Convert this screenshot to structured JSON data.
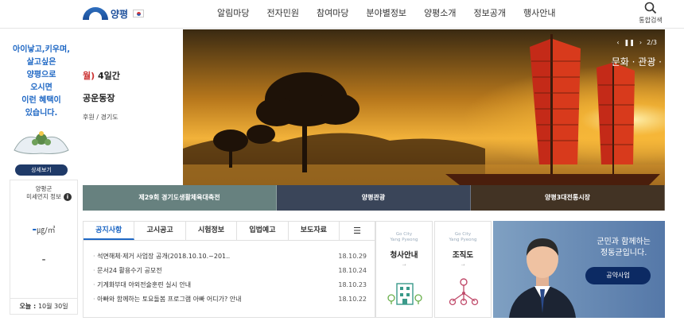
{
  "header": {
    "logo_text": "양평",
    "nav": [
      "알림마당",
      "전자민원",
      "참여마당",
      "분야별정보",
      "양평소개",
      "정보공개",
      "행사안내"
    ],
    "search_label": "통합검색"
  },
  "sidebar": {
    "promo_text": "아이낳고,키우며,\n살고싶은\n양평으로\n오시면\n이런 혜택이\n있습니다.",
    "promo_button": "상세보기",
    "dust_title_line1": "양평군",
    "dust_title_line2": "미세먼지 정보",
    "dust_info_icon": "i",
    "dust_value": "-",
    "dust_unit": "㎍/㎥",
    "dust_level": "-",
    "date_prefix": "오늘 : ",
    "date_value": "10월 30일"
  },
  "hero": {
    "left_line1_red": "월)",
    "left_line1": " 4일간",
    "left_line2": "공운동장",
    "left_line3": "후원 / 경기도",
    "controls_prev": "‹",
    "controls_pause": "❚❚",
    "controls_next": "›",
    "page_indicator": "2/3",
    "caption": "문화 · 관광 ·",
    "tabs": [
      "제29회 경기도생활체육대축전",
      "양평관광",
      "양평3대전통시장"
    ]
  },
  "board": {
    "tabs": [
      "공지사항",
      "고시공고",
      "시험정보",
      "입법예고",
      "보도자료"
    ],
    "menu_icon": "☰",
    "active_tab": 0,
    "rows": [
      {
        "title": "석면해체·제거 사업장 공개(2018.10.10.~201..",
        "date": "18.10.29"
      },
      {
        "title": "문서24 활용수기 공모전",
        "date": "18.10.24"
      },
      {
        "title": "기계화부대 야외전술훈련 실시 안내",
        "date": "18.10.23"
      },
      {
        "title": "아빠와 함께하는 토요돌봄 프로그램 아빠 어디가? 안내",
        "date": "18.10.22"
      }
    ]
  },
  "tiles": [
    {
      "sub1": "Go City",
      "sub2": "Yang Pyeong",
      "title": "청사안내",
      "arrow": "→"
    },
    {
      "sub1": "Go City",
      "sub2": "Yang Pyeong",
      "title": "조직도",
      "arrow": "→"
    }
  ],
  "mayor": {
    "text": "군민과 함께하는\n정동균입니다.",
    "button": "공약사업"
  },
  "colors": {
    "accent": "#1e67c4",
    "navy": "#1f3a68",
    "banner": "#6b8db6"
  }
}
